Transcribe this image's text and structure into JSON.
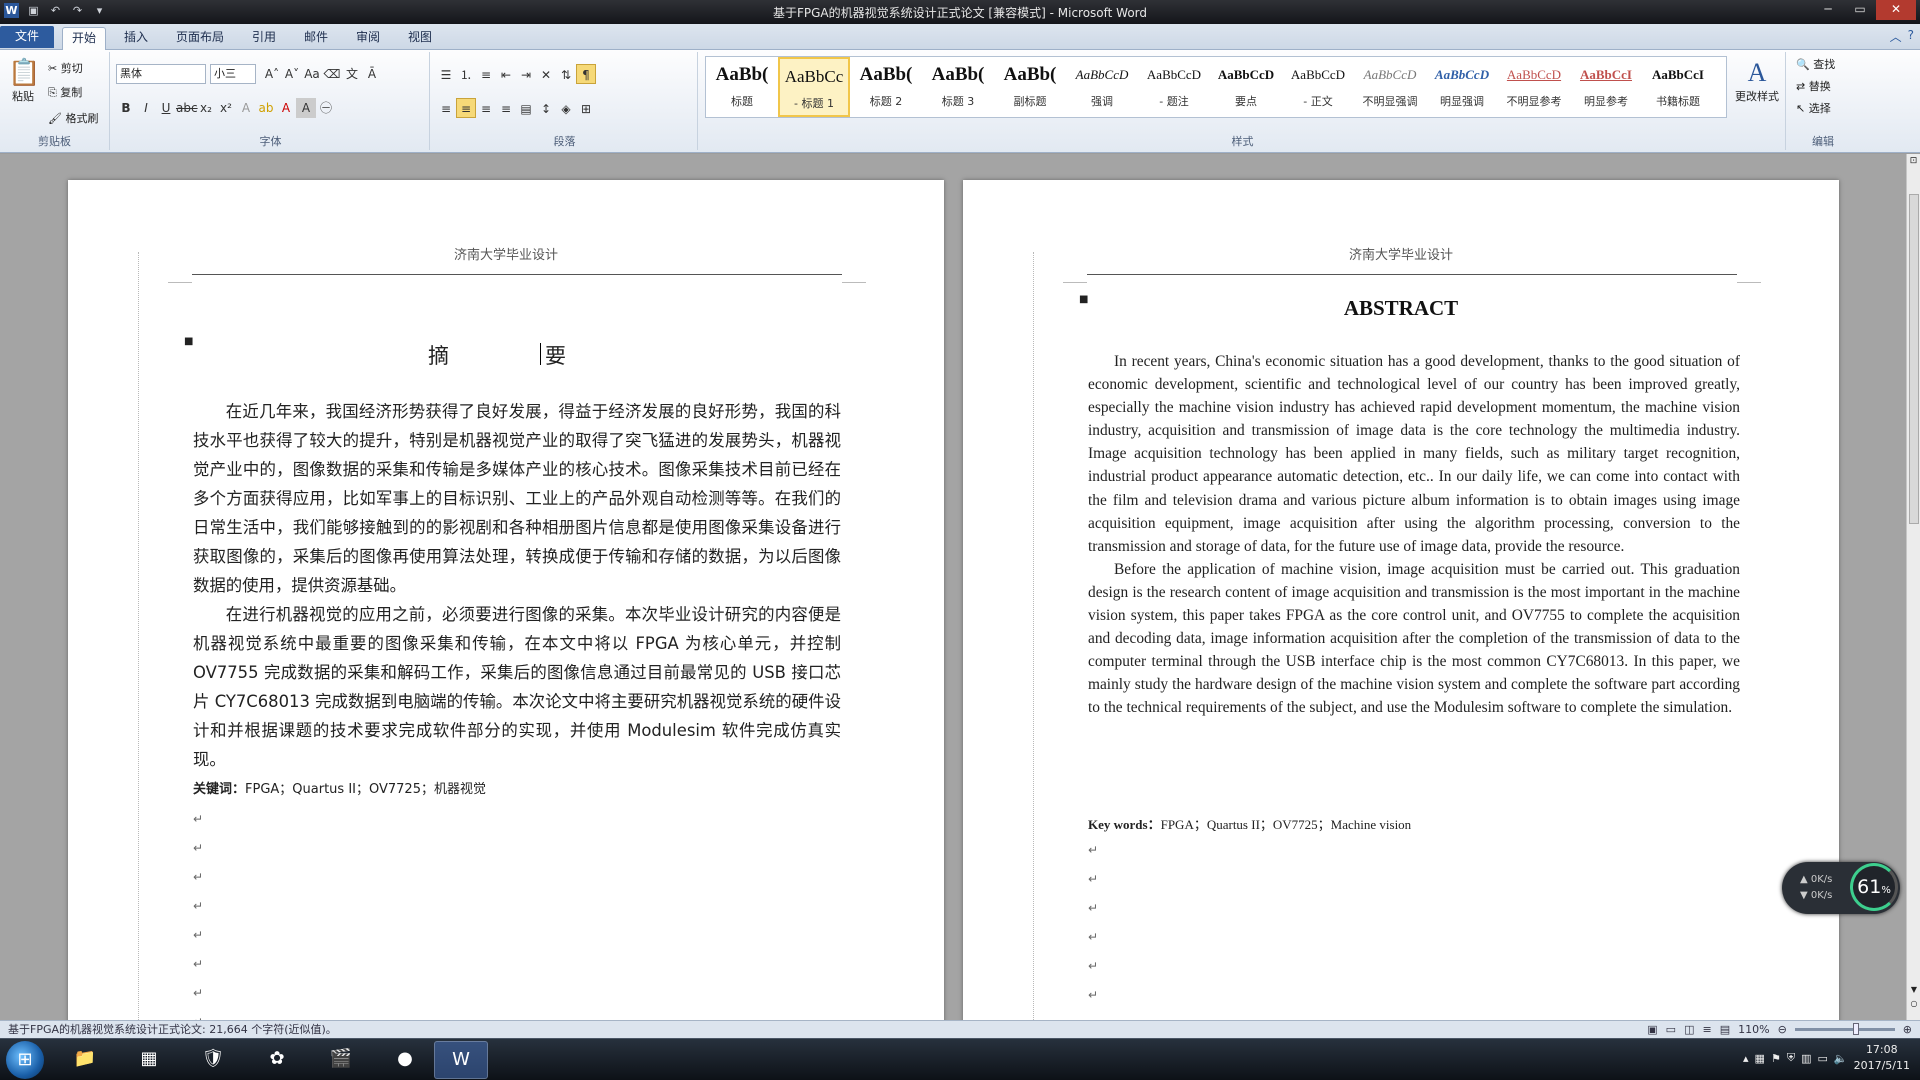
{
  "window": {
    "title": "基于FPGA的机器视觉系统设计正式论文 [兼容模式] - Microsoft Word",
    "minimize": "─",
    "maximize": "▭",
    "close": "✕"
  },
  "tabs": [
    "文件",
    "开始",
    "插入",
    "页面布局",
    "引用",
    "邮件",
    "审阅",
    "视图"
  ],
  "ribbon": {
    "clipboard": {
      "label": "剪贴板",
      "paste": "粘贴",
      "cut": "剪切",
      "copy": "复制",
      "format_painter": "格式刷"
    },
    "font": {
      "label": "字体",
      "font_name": "黑体",
      "font_size": "小三"
    },
    "paragraph": {
      "label": "段落"
    },
    "styles": {
      "label": "样式",
      "change_styles": "更改样式",
      "items": [
        {
          "preview": "AaBb(",
          "name": "标题"
        },
        {
          "preview": "AaBbCc",
          "name": "- 标题 1"
        },
        {
          "preview": "AaBb(",
          "name": "标题 2"
        },
        {
          "preview": "AaBb(",
          "name": "标题 3"
        },
        {
          "preview": "AaBb(",
          "name": "副标题"
        },
        {
          "preview": "AaBbCcD",
          "name": "强调"
        },
        {
          "preview": "AaBbCcD",
          "name": "- 题注"
        },
        {
          "preview": "AaBbCcD",
          "name": "要点"
        },
        {
          "preview": "AaBbCcD",
          "name": "- 正文"
        },
        {
          "preview": "AaBbCcD",
          "name": "不明显强调"
        },
        {
          "preview": "AaBbCcD",
          "name": "明显强调"
        },
        {
          "preview": "AaBbCcD",
          "name": "不明显参考"
        },
        {
          "preview": "AaBbCcI",
          "name": "明显参考"
        },
        {
          "preview": "AaBbCcI",
          "name": "书籍标题"
        }
      ]
    },
    "editing": {
      "label": "编辑",
      "find": "查找",
      "replace": "替换",
      "select": "选择"
    }
  },
  "page_left": {
    "header": "济南大学毕业设计",
    "title": "摘　　要",
    "paragraphs": [
      "在近几年来，我国经济形势获得了良好发展，得益于经济发展的良好形势，我国的科技水平也获得了较大的提升，特别是机器视觉产业的取得了突飞猛进的发展势头，机器视觉产业中的，图像数据的采集和传输是多媒体产业的核心技术。图像采集技术目前已经在多个方面获得应用，比如军事上的目标识别、工业上的产品外观自动检测等等。在我们的日常生活中，我们能够接触到的的影视剧和各种相册图片信息都是使用图像采集设备进行获取图像的，采集后的图像再使用算法处理，转换成便于传输和存储的数据，为以后图像数据的使用，提供资源基础。",
      "在进行机器视觉的应用之前，必须要进行图像的采集。本次毕业设计研究的内容便是机器视觉系统中最重要的图像采集和传输，在本文中将以 FPGA 为核心单元，并控制 OV7755 完成数据的采集和解码工作，采集后的图像信息通过目前最常见的 USB 接口芯片 CY7C68013 完成数据到电脑端的传输。本次论文中将主要研究机器视觉系统的硬件设计和并根据课题的技术要求完成软件部分的实现，并使用 Modulesim 软件完成仿真实现。"
    ],
    "keywords_label": "关键词：",
    "keywords": "FPGA；Quartus II；OV7725；机器视觉"
  },
  "page_right": {
    "header": "济南大学毕业设计",
    "title": "ABSTRACT",
    "paragraphs": [
      "In recent years, China's economic situation has a good development, thanks to the good situation of economic development, scientific and technological level of our country has been improved greatly, especially the machine vision industry has achieved rapid development momentum, the machine vision industry, acquisition and transmission of image data is the core technology the multimedia industry. Image acquisition technology has been applied in many fields, such as military target recognition, industrial product appearance automatic detection, etc.. In our daily life, we can come into contact with the film and television drama and various picture album information is to obtain images using image acquisition equipment, image acquisition after using the algorithm processing, conversion to the transmission and storage of data, for the future use of image data, provide the resource.",
      "Before the application of machine vision, image acquisition must be carried out. This graduation design is the research content of image acquisition and transmission is the most important in the machine vision system, this paper takes FPGA as the core control unit, and OV7755 to complete the acquisition and decoding data, image information acquisition after the completion of the transmission of data to the computer terminal through the USB interface chip is the most common CY7C68013. In this paper, we mainly study the hardware design of the machine vision system and complete the software part according to the technical requirements of the subject, and use the Modulesim software to complete the simulation."
    ],
    "keywords_label": "Key words：",
    "keywords": "FPGA；Quartus II；OV7725；Machine vision"
  },
  "status_bar": {
    "doc_info": "基于FPGA的机器视觉系统设计正式论文: 21,664 个字符(近似值)。",
    "zoom": "110%"
  },
  "net_widget": {
    "up": "0K/s",
    "down": "0K/s",
    "percent": "61"
  },
  "taskbar": {
    "time": "17:08",
    "date": "2017/5/11"
  }
}
